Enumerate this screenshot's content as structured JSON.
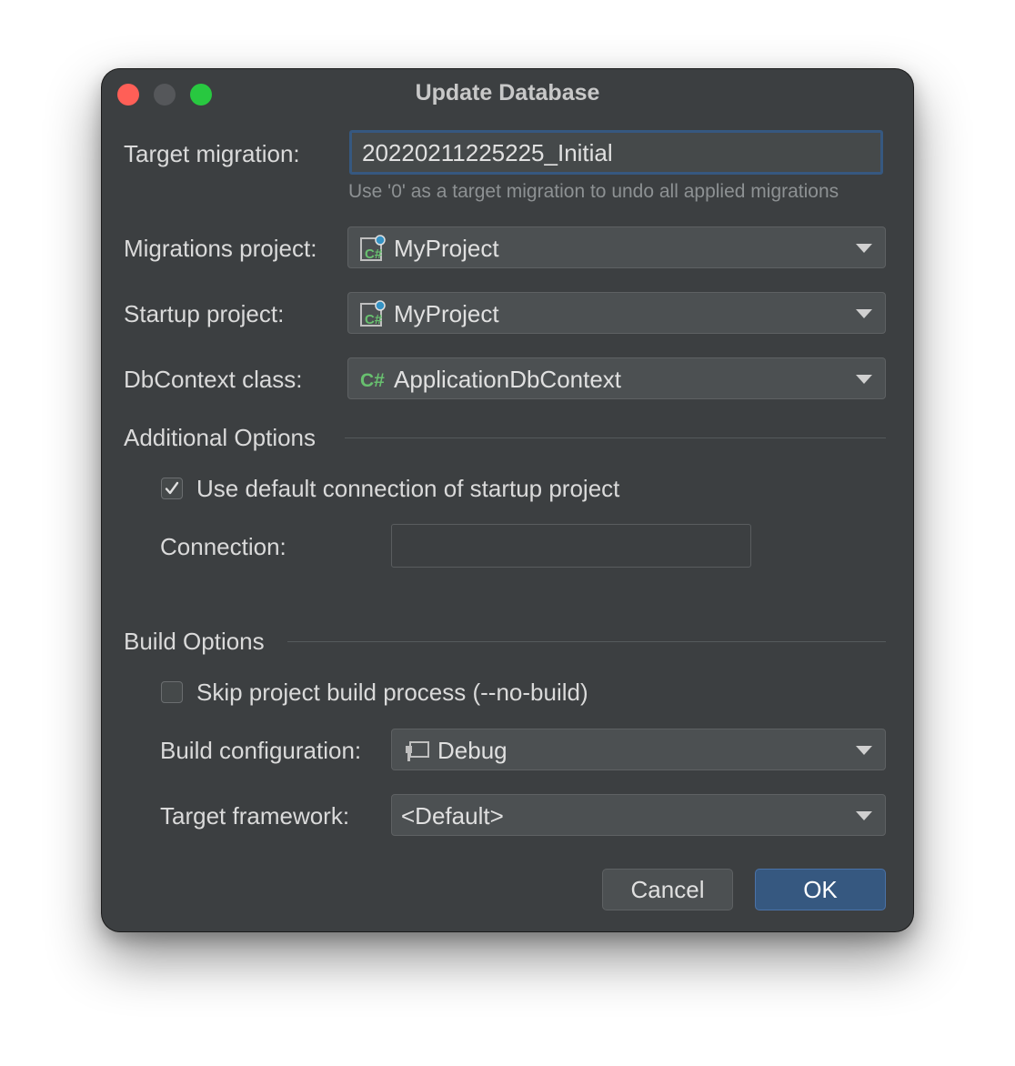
{
  "window": {
    "title": "Update Database"
  },
  "fields": {
    "target_migration": {
      "label": "Target migration:",
      "value": "20220211225225_Initial",
      "hint": "Use '0' as a target migration to undo all applied migrations"
    },
    "migrations_project": {
      "label": "Migrations project:",
      "value": "MyProject",
      "icon": "csharp-project-icon"
    },
    "startup_project": {
      "label": "Startup project:",
      "value": "MyProject",
      "icon": "csharp-project-icon"
    },
    "dbcontext_class": {
      "label": "DbContext class:",
      "value": "ApplicationDbContext",
      "icon": "csharp-class-icon"
    }
  },
  "additional_options": {
    "title": "Additional Options",
    "use_default_connection": {
      "label": "Use default connection of startup project",
      "checked": true
    },
    "connection": {
      "label": "Connection:",
      "value": ""
    }
  },
  "build_options": {
    "title": "Build Options",
    "skip_build": {
      "label": "Skip project build process (--no-build)",
      "checked": false
    },
    "build_configuration": {
      "label": "Build configuration:",
      "value": "Debug",
      "icon": "build-configuration-icon"
    },
    "target_framework": {
      "label": "Target framework:",
      "value": "<Default>"
    }
  },
  "buttons": {
    "cancel": "Cancel",
    "ok": "OK"
  },
  "colors": {
    "accent": "#365880",
    "csharp_green": "#68c06f",
    "background": "#3c3f41"
  }
}
